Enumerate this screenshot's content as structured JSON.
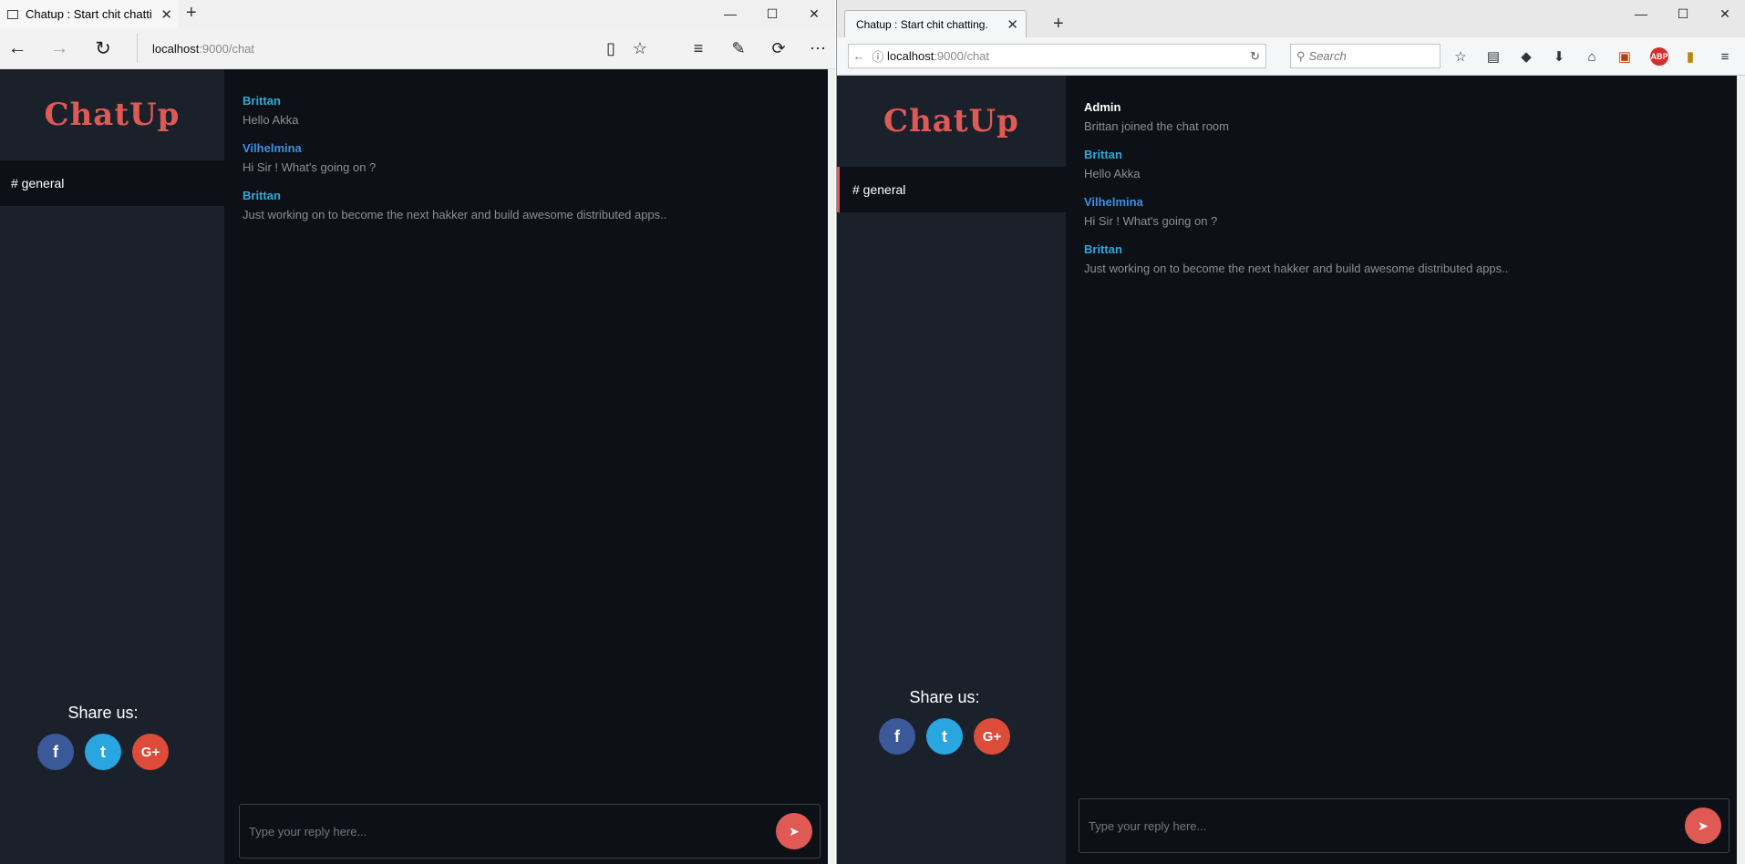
{
  "edge": {
    "tab_title": "Chatup : Start chit chatti",
    "url_host": "localhost",
    "url_path": ":9000/chat",
    "back_icon": "←",
    "forward_icon": "→",
    "refresh_icon": "↻",
    "reading_icon": "▯",
    "favorite_icon": "☆",
    "hub_icon": "≡",
    "notes_icon": "✎",
    "share_icon": "⟳",
    "more_icon": "⋯",
    "new_tab": "+",
    "close_tab": "✕",
    "minimize": "—",
    "maximize": "☐",
    "close_window": "✕"
  },
  "firefox": {
    "tab_title": "Chatup : Start chit chatting.",
    "url_host": "localhost",
    "url_path": ":9000/chat",
    "search_placeholder": "Search",
    "back_icon": "←",
    "info_icon": "ⓘ",
    "reload_icon": "↻",
    "search_icon": "⚲",
    "new_tab": "+",
    "close_tab": "✕",
    "minimize": "—",
    "maximize": "☐",
    "close_window": "✕",
    "tools": [
      "☆",
      "▤",
      "◆",
      "⬇",
      "⌂",
      "▣",
      "ABP",
      "▮",
      "≡"
    ]
  },
  "app": {
    "logo": "ChatUp",
    "channel": "# general",
    "share_label": "Share us:",
    "social": [
      "f",
      "t",
      "G+"
    ],
    "reply_placeholder": "Type your reply here...",
    "send_icon": "➤"
  },
  "colors": {
    "accent": "#e05a55",
    "admin": "#ffffff",
    "brittan": "#2fa8d8",
    "vilhelmina": "#3b8fe0"
  },
  "edge_messages": [
    {
      "author": "Brittan",
      "text": "Hello Akka",
      "color": "#2fa8d8"
    },
    {
      "author": "Vilhelmina",
      "text": "Hi Sir ! What's going on ?",
      "color": "#3b8fe0"
    },
    {
      "author": "Brittan",
      "text": "Just working on to become the next hakker and build awesome distributed apps..",
      "color": "#2fa8d8"
    }
  ],
  "firefox_messages": [
    {
      "author": "Admin",
      "text": "Brittan joined the chat room",
      "color": "#ffffff"
    },
    {
      "author": "Brittan",
      "text": "Hello Akka",
      "color": "#2fa8d8"
    },
    {
      "author": "Vilhelmina",
      "text": "Hi Sir ! What's going on ?",
      "color": "#3b8fe0"
    },
    {
      "author": "Brittan",
      "text": "Just working on to become the next hakker and build awesome distributed apps..",
      "color": "#2fa8d8"
    }
  ]
}
